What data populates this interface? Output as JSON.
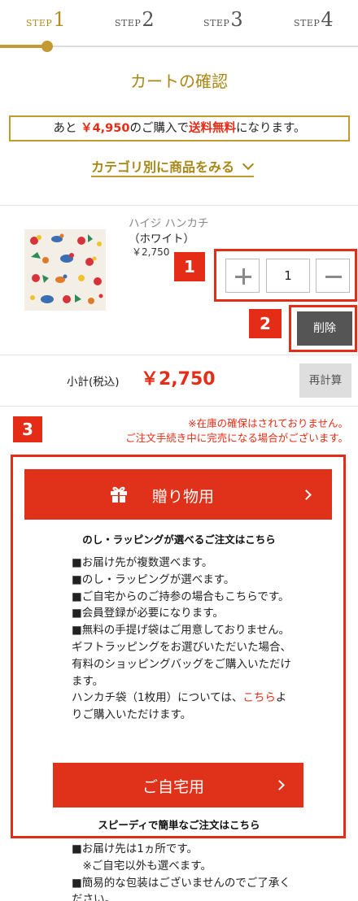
{
  "steps": [
    {
      "label": "STEP",
      "num": "1"
    },
    {
      "label": "STEP",
      "num": "2"
    },
    {
      "label": "STEP",
      "num": "3"
    },
    {
      "label": "STEP",
      "num": "4"
    }
  ],
  "title": "カートの確認",
  "shipping_notice": {
    "pre": "あと",
    "amount": "￥4,950",
    "mid": "のご購入で",
    "free": "送料無料",
    "post": "になります。"
  },
  "category_link": "カテゴリ別に商品をみる",
  "product": {
    "name": "ハイジ ハンカチ",
    "variant": "（ホワイト）",
    "price": "￥2,750",
    "quantity": "1"
  },
  "badges": {
    "one": "1",
    "two": "2",
    "three": "3"
  },
  "delete_label": "削除",
  "subtotal": {
    "label": "小計(税込)",
    "value": "￥2,750"
  },
  "recalc_label": "再計算",
  "stock_note": {
    "line1": "※在庫の確保はされておりません。",
    "line2": "ご注文手続き中に完売になる場合がございます。"
  },
  "gift": {
    "button_label": "贈り物用",
    "subhead": "のし・ラッピングが選べるご注文はこちら",
    "items": [
      "■お届け先が複数選べます。",
      "■のし・ラッピングが選べます。",
      "■ご自宅からのご持参の場合もこちらです。",
      "■会員登録が必要になります。",
      "■無料の手提げ袋はご用意しておりません。ギフトラッピングをお選びいただいた場合、有料のショッピングバッグをご購入いただけます。"
    ],
    "bag_note_pre": "ハンカチ袋（1枚用）については、",
    "bag_note_link": "こちら",
    "bag_note_post": "よりご購入いただけます。"
  },
  "home": {
    "button_label": "ご自宅用",
    "subhead": "スピーディで簡単なご注文はこちら",
    "items": [
      "■お届け先は1ヵ所です。",
      "　※ご自宅以外も選べます。",
      "■簡易的な包装はございませんのでご了承ください。"
    ]
  },
  "colors": {
    "accent_gold": "#c39a32",
    "brand_red": "#e0321a",
    "annotation_red": "#e42c16"
  }
}
